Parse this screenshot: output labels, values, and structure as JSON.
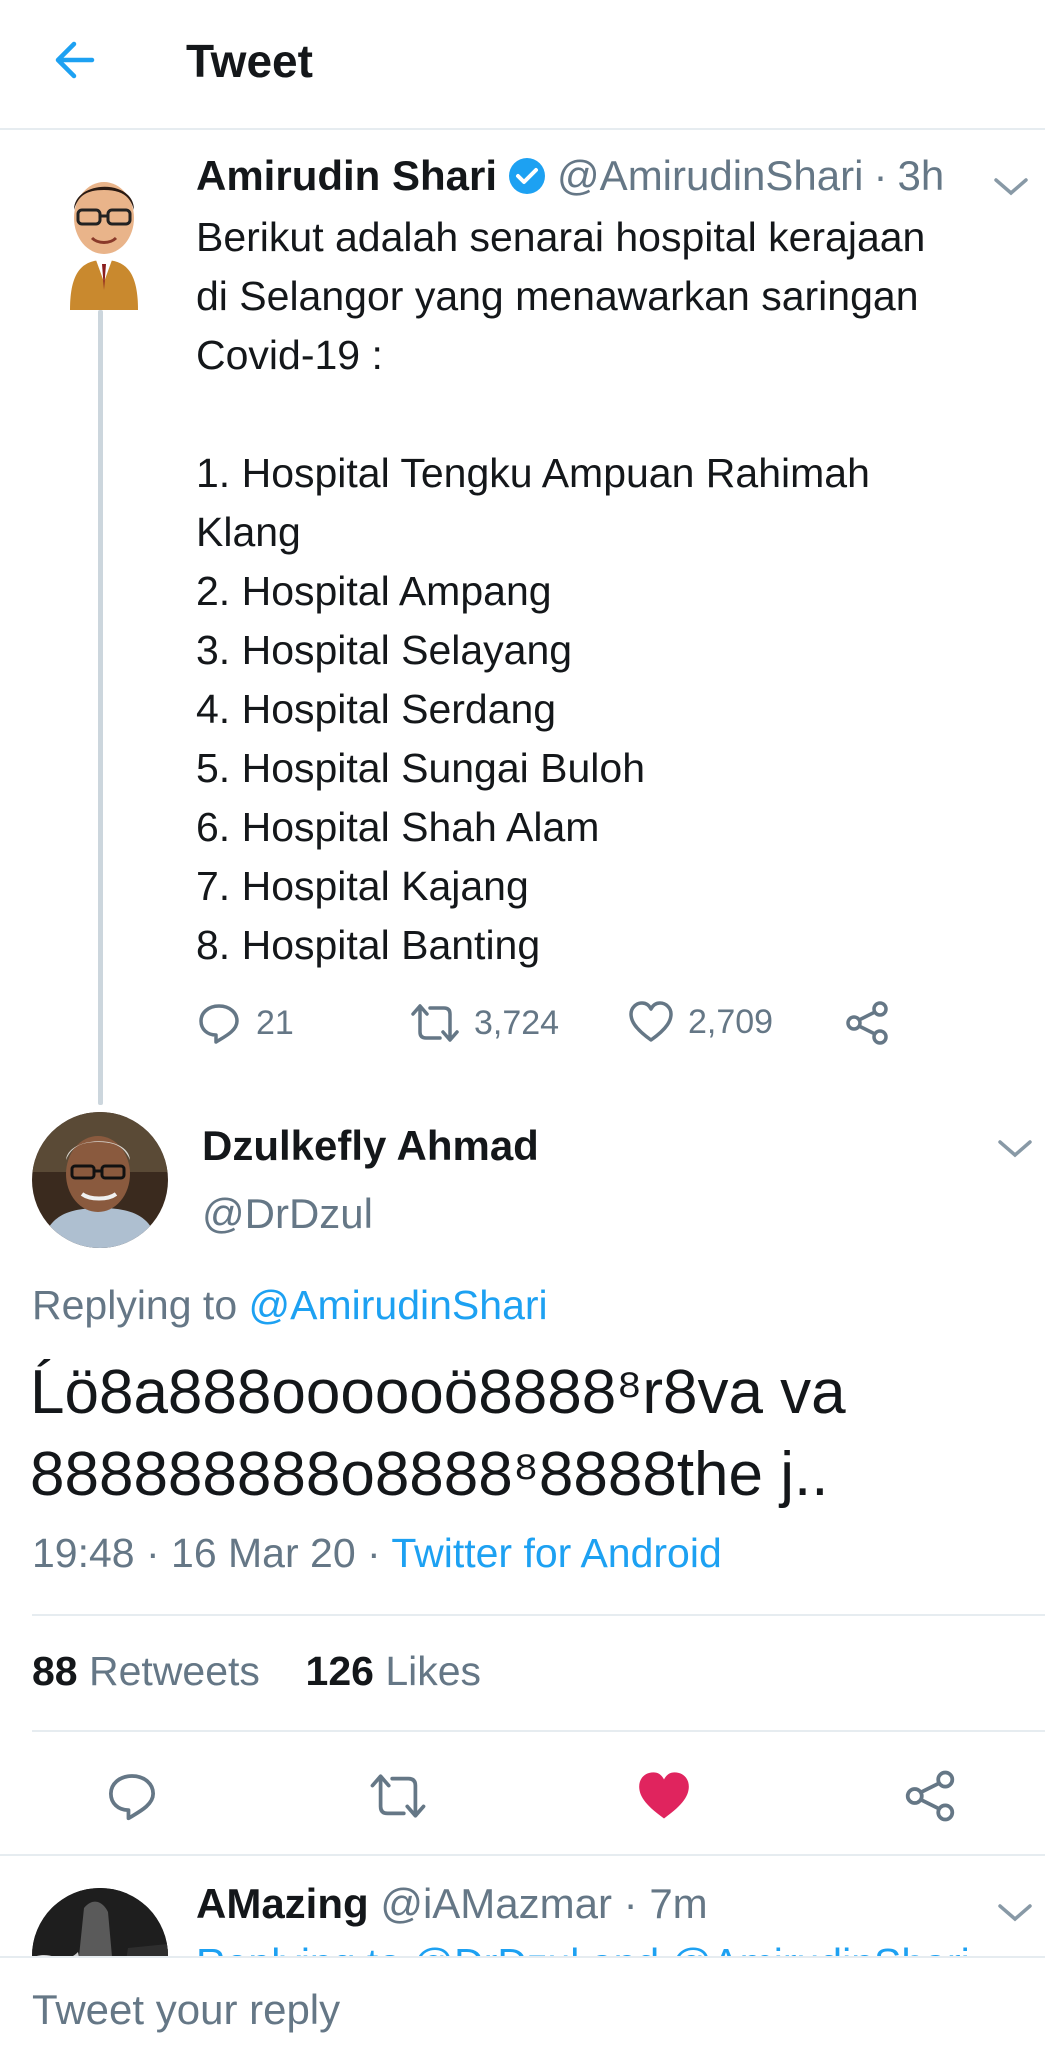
{
  "header": {
    "title": "Tweet"
  },
  "parent_tweet": {
    "name": "Amirudin Shari",
    "handle": "@AmirudinShari",
    "separator": "·",
    "time": "3h",
    "text": "Berikut adalah senarai hospital kerajaan\ndi Selangor yang menawarkan saringan\nCovid-19 :\n\n1. Hospital Tengku Ampuan Rahimah\nKlang\n2. Hospital Ampang\n3. Hospital Selayang\n4. Hospital Serdang\n5. Hospital Sungai Buloh\n6. Hospital Shah Alam\n7. Hospital Kajang\n8. Hospital Banting",
    "replies": "21",
    "retweets": "3,724",
    "likes": "2,709"
  },
  "main_tweet": {
    "name": "Dzulkefly Ahmad",
    "handle": "@DrDzul",
    "replying_prefix": "Replying to",
    "replying_to": "@AmirudinShari",
    "text": "Ĺö8a888oooooö8888⁸r8va va 888888888o8888⁸8888the j..",
    "timestamp": "19:48 · 16 Mar 20 ·",
    "client": "Twitter for Android",
    "retweet_count": "88",
    "retweet_label": "Retweets",
    "like_count": "126",
    "like_label": "Likes",
    "liked": true,
    "like_color": "#e0245e"
  },
  "next_reply": {
    "name": "AMazing",
    "handle": "@iAMazmar",
    "separator": "·",
    "time": "7m",
    "replying_line": "Replying to @DrDzul and @AmirudinShari"
  },
  "composer": {
    "placeholder": "Tweet your reply"
  },
  "colors": {
    "accent": "#1da1f2",
    "muted": "#657786",
    "divider": "#e6ecf0"
  }
}
